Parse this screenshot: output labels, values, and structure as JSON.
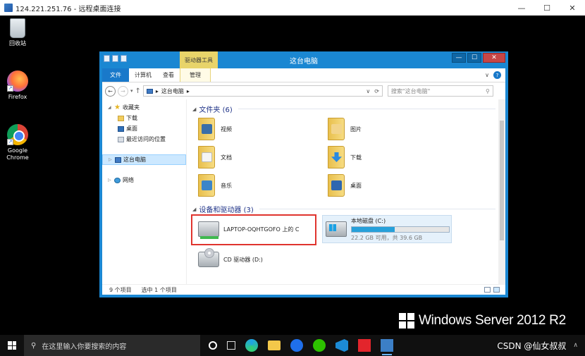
{
  "rdp": {
    "title": "124.221.251.76 - 远程桌面连接",
    "controls": {
      "minimize": "—",
      "maximize": "☐",
      "close": "✕"
    }
  },
  "desktop": {
    "icons": [
      {
        "name": "recycle-bin",
        "label": "回收站"
      },
      {
        "name": "firefox",
        "label": "Firefox"
      },
      {
        "name": "google-chrome",
        "label": "Google Chrome"
      }
    ],
    "branding": "Windows Server 2012 R2"
  },
  "explorer": {
    "title": "这台电脑",
    "contextual_tab_group": "驱动器工具",
    "tabs": {
      "file": "文件",
      "computer": "计算机",
      "view": "查看",
      "manage": "管理"
    },
    "controls": {
      "minimize": "—",
      "maximize": "☐",
      "close": "✕"
    },
    "ribbon_expand": "∨",
    "help": "?",
    "nav": {
      "back": "←",
      "forward": "→",
      "recent": "▾",
      "up": "↑"
    },
    "address": {
      "separator": "▸",
      "location": "这台电脑",
      "trailing": "▸",
      "dropdown": "∨",
      "refresh": "⟳"
    },
    "search": {
      "placeholder": "搜索\"这台电脑\"",
      "icon": "⚲"
    },
    "sidebar": {
      "favorites": "收藏夹",
      "favorites_items": [
        "下载",
        "桌面",
        "最近访问的位置"
      ],
      "this_pc": "这台电脑",
      "network": "网络",
      "expander": "▷"
    },
    "folders_header": "文件夹 (6)",
    "folders": [
      "视频",
      "图片",
      "文档",
      "下载",
      "音乐",
      "桌面"
    ],
    "devices_header": "设备和驱动器 (3)",
    "devices": {
      "network_drive": "LAPTOP-OQHTGOFO 上的 C",
      "local_disk": {
        "name": "本地磁盘 (C:)",
        "free": "22.2 GB 可用，共 39.6 GB",
        "used_fraction": 0.44
      },
      "cd_drive": "CD 驱动器 (D:)"
    },
    "status": {
      "item_count": "9 个项目",
      "selected": "选中 1 个项目"
    }
  },
  "taskbar": {
    "search_placeholder": "在这里输入你要搜索的内容",
    "search_icon": "⚲",
    "overlay_text": "CSDN @仙女叔叔",
    "tray_arrow": "∧"
  },
  "colors": {
    "explorer_frame": "#1a87d2",
    "file_tab": "#1979ca",
    "context_tab": "#e8d46a",
    "highlight": "#e0342e",
    "disk_bar": "#26a0da"
  }
}
